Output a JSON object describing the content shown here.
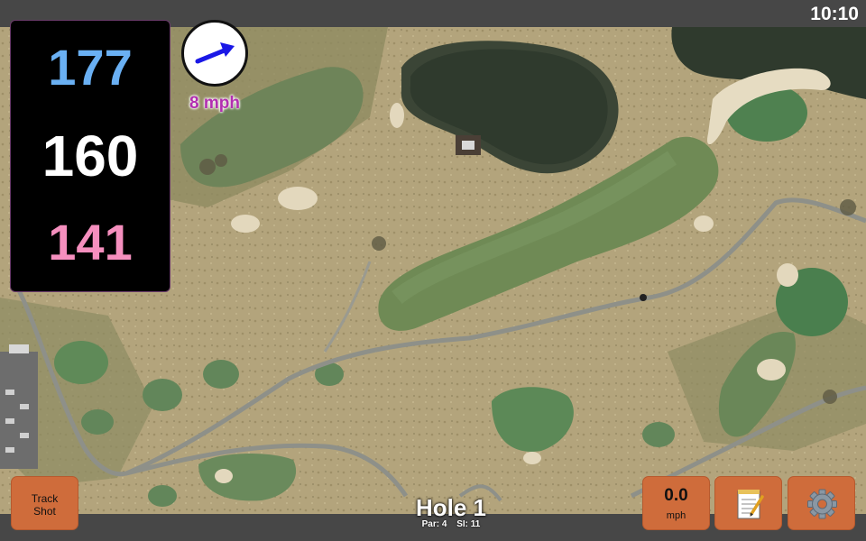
{
  "status_bar": {
    "time": "10:10"
  },
  "distances": {
    "back": "177",
    "middle": "160",
    "front": "141"
  },
  "wind": {
    "speed": "8 mph",
    "direction": "east-north-east"
  },
  "buttons": {
    "track_shot_line1": "Track",
    "track_shot_line2": "Shot",
    "speed_value": "0.0",
    "speed_unit": "mph"
  },
  "hole": {
    "title": "Hole 1",
    "par": "Par: 4",
    "si": "SI: 11"
  },
  "icons": {
    "wind": "arrow-icon",
    "notes": "notepad-icon",
    "settings": "gear-icon"
  },
  "colors": {
    "back_distance": "#6ab0f3",
    "middle_distance": "#ffffff",
    "front_distance": "#f58fbe",
    "wind_text": "#b22fb0",
    "button": "#cf6c3b",
    "wind_arrow": "#1a18e6"
  }
}
